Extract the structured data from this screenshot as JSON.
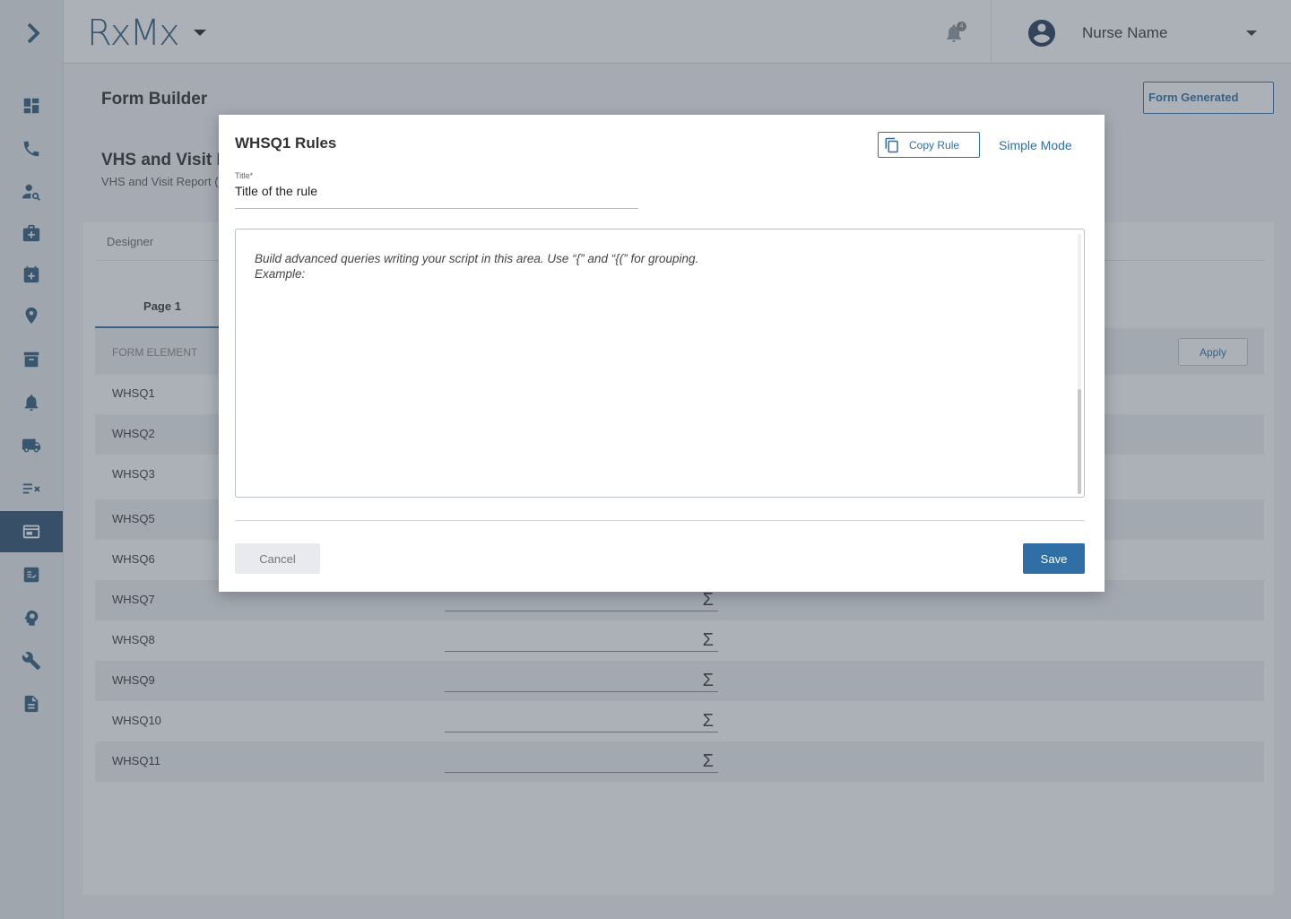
{
  "header": {
    "logo": "RxMx",
    "notification_count": "4",
    "user_name": "Nurse Name"
  },
  "page": {
    "title": "Form Builder",
    "status_button": "Form Generated",
    "form_title": "VHS and Visit Re",
    "form_subtitle": "VHS and Visit Report (I"
  },
  "designer": {
    "tab": "Designer",
    "page_tab": "Page 1",
    "column_header": "FORM ELEMENT",
    "apply_label": "Apply",
    "rows": [
      {
        "label": "WHSQ1"
      },
      {
        "label": "WHSQ2"
      },
      {
        "label": "WHSQ3"
      },
      {
        "label": "WHSQ5"
      },
      {
        "label": "WHSQ6"
      },
      {
        "label": "WHSQ7"
      },
      {
        "label": "WHSQ8"
      },
      {
        "label": "WHSQ9"
      },
      {
        "label": "WHSQ10"
      },
      {
        "label": "WHSQ11"
      }
    ],
    "sigma": "Σ"
  },
  "sidebar": {
    "items": [
      {
        "icon": "dashboard-icon"
      },
      {
        "icon": "phone-icon"
      },
      {
        "icon": "patient-search-icon"
      },
      {
        "icon": "medical-kit-icon"
      },
      {
        "icon": "calendar-add-icon"
      },
      {
        "icon": "location-pin-icon"
      },
      {
        "icon": "archive-icon"
      },
      {
        "icon": "bell-icon"
      },
      {
        "icon": "truck-icon"
      },
      {
        "icon": "list-check-icon"
      },
      {
        "icon": "form-builder-icon"
      },
      {
        "icon": "checklist-icon"
      },
      {
        "icon": "brain-gear-icon"
      },
      {
        "icon": "wrench-icon"
      },
      {
        "icon": "document-icon"
      }
    ]
  },
  "modal": {
    "title": "WHSQ1 Rules",
    "copy_rule_label": "Copy Rule",
    "simple_mode_label": "Simple Mode",
    "field_label": "Title*",
    "field_value": "Title of the rule",
    "hint_line1": "Build advanced queries writing your script in this area. Use “{” and “{(” for grouping.",
    "hint_line2": "Example:",
    "cancel_label": "Cancel",
    "save_label": "Save"
  },
  "colors": {
    "accent": "#2f6fa5",
    "sidebar_active": "#2a4e6e",
    "overlay": "rgba(70,82,96,0.45)"
  }
}
